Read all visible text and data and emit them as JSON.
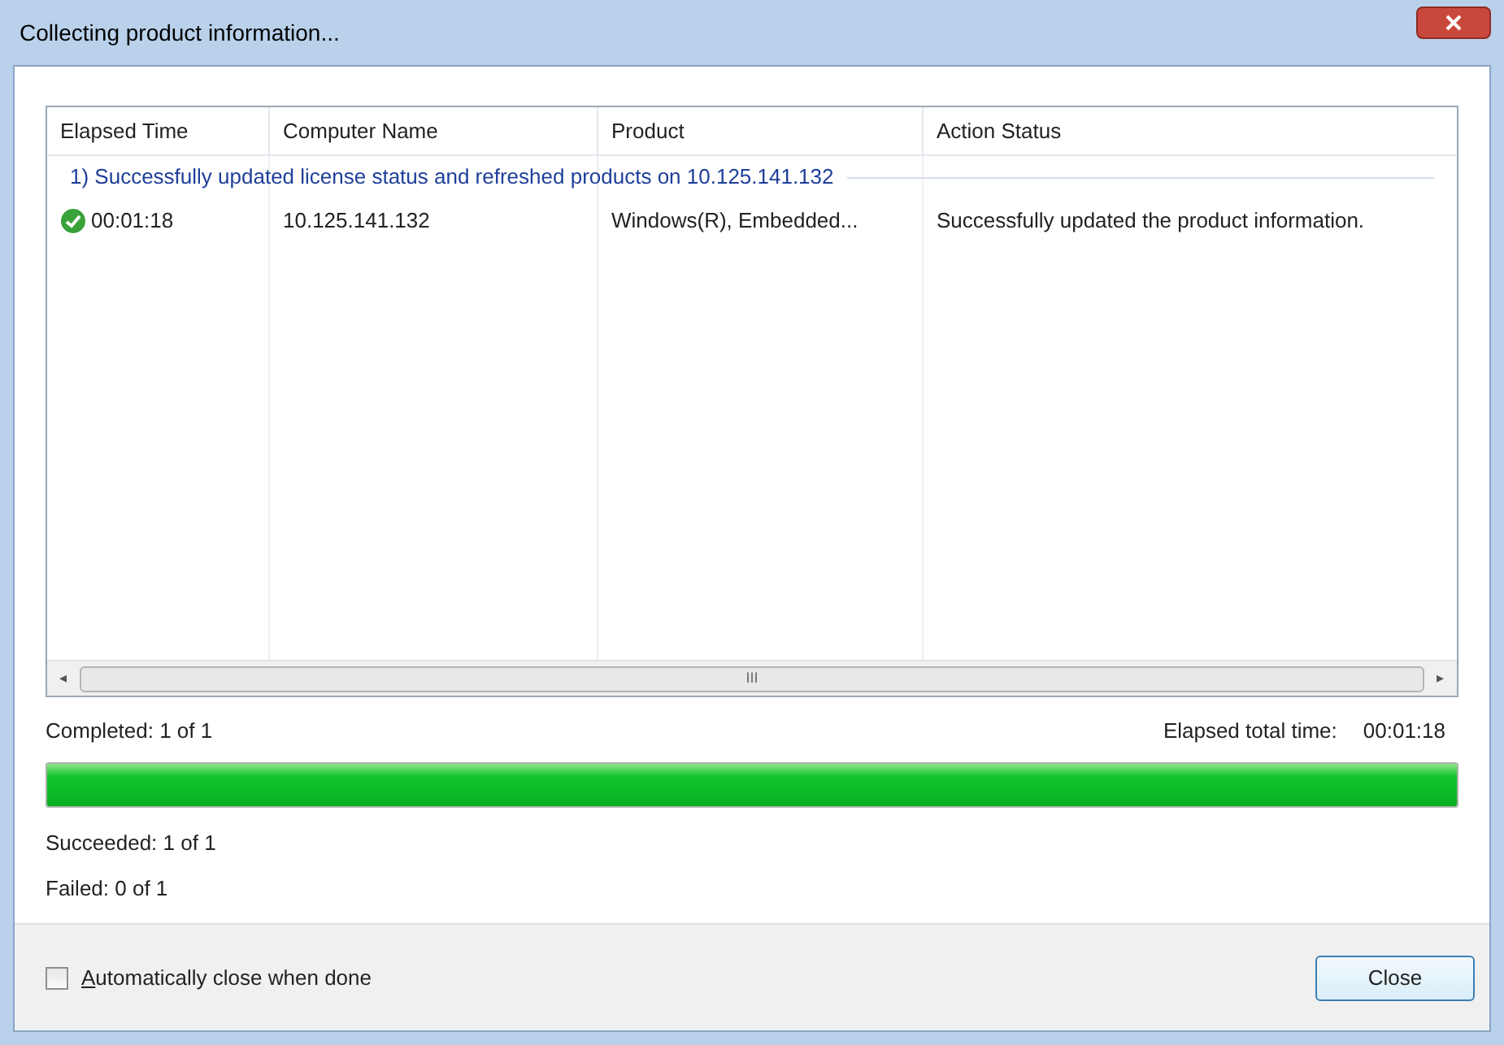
{
  "window": {
    "title": "Collecting product information..."
  },
  "table": {
    "columns": [
      "Elapsed Time",
      "Computer Name",
      "Product",
      "Action Status"
    ],
    "group": {
      "label": "1) Successfully updated license status and refreshed products on 10.125.141.132"
    },
    "rows": [
      {
        "kind": "success",
        "cells": [
          "00:01:18",
          "10.125.141.132",
          "Windows(R), Embedded...",
          "Successfully updated the product information."
        ]
      }
    ],
    "scrollbar": {
      "thumb": "III",
      "left": "◂",
      "right": "▸"
    }
  },
  "summary": {
    "completed": "Completed: 1 of 1",
    "elapsed_label": "Elapsed total time:",
    "elapsed_value": "00:01:18",
    "progress": {
      "level": 1
    },
    "succeeded": "Succeeded: 1 of 1",
    "failed": "Failed: 0 of 1"
  },
  "footer": {
    "auto_close": {
      "label": "Automatically close when done",
      "checked": false
    },
    "close_button": "Close"
  }
}
